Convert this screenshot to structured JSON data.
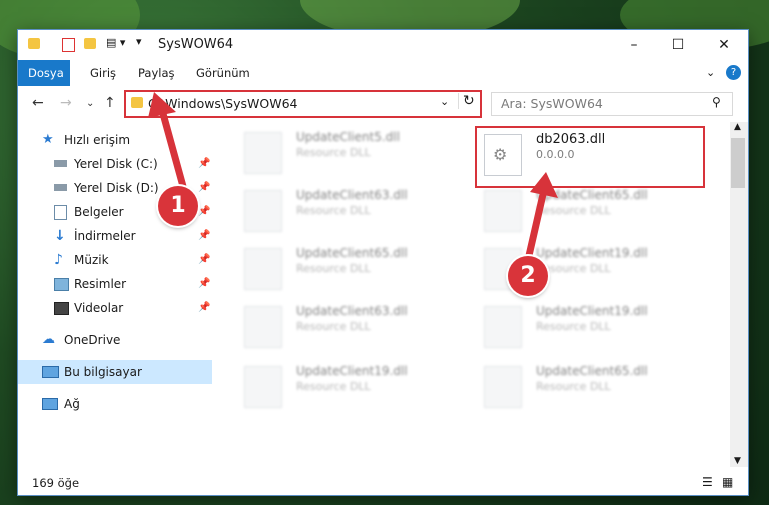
{
  "window": {
    "title": "SysWOW64"
  },
  "ribbon": {
    "tabs": [
      "Dosya",
      "Giriş",
      "Paylaş",
      "Görünüm"
    ]
  },
  "address": {
    "path": "C:\\Windows\\SysWOW64",
    "search_placeholder": "Ara: SysWOW64"
  },
  "sidebar": {
    "quick_access": "Hızlı erişim",
    "items": [
      {
        "label": "Yerel Disk (C:)",
        "icon": "drive-icon"
      },
      {
        "label": "Yerel Disk (D:)",
        "icon": "drive-icon"
      },
      {
        "label": "Belgeler",
        "icon": "documents-icon"
      },
      {
        "label": "İndirmeler",
        "icon": "download-icon"
      },
      {
        "label": "Müzik",
        "icon": "music-icon"
      },
      {
        "label": "Resimler",
        "icon": "pictures-icon"
      },
      {
        "label": "Videolar",
        "icon": "videos-icon"
      }
    ],
    "onedrive": "OneDrive",
    "this_pc": "Bu bilgisayar",
    "network": "Ağ"
  },
  "files": {
    "highlighted": {
      "name": "db2063.dll",
      "desc": "0.0.0.0"
    },
    "left": [
      {
        "name": "UpdateClient5.dll",
        "desc": "Resource DLL"
      },
      {
        "name": "UpdateClient63.dll",
        "desc": "Resource DLL"
      },
      {
        "name": "UpdateClient65.dll",
        "desc": "Resource DLL"
      },
      {
        "name": "UpdateClient63.dll",
        "desc": "Resource DLL"
      },
      {
        "name": "UpdateClient19.dll",
        "desc": "Resource DLL"
      }
    ],
    "right": [
      {
        "name": "UpdateClient65.dll",
        "desc": "Resource DLL"
      },
      {
        "name": "UpdateClient19.dll",
        "desc": "Resource DLL"
      },
      {
        "name": "UpdateClient19.dll",
        "desc": "Resource DLL"
      },
      {
        "name": "UpdateClient65.dll",
        "desc": "Resource DLL"
      }
    ]
  },
  "status": {
    "count": "169 öğe"
  },
  "annotations": {
    "badge1": "1",
    "badge2": "2"
  },
  "colors": {
    "accent": "#1979ca",
    "highlight": "#d7333a"
  }
}
